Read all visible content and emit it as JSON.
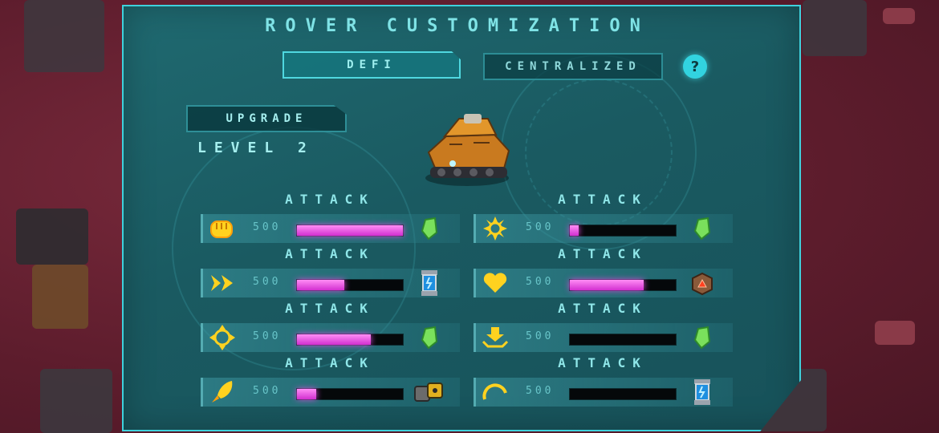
{
  "title": "ROVER CUSTOMIZATION",
  "tabs": {
    "defi": "DEFI",
    "centralized": "CENTRALIZED"
  },
  "help_label": "?",
  "upgrade_label": "UPGRADE",
  "level_label": "LEVEL 2",
  "colors": {
    "accent": "#3fd1dc",
    "bar_fill": "#e04ae0",
    "icon": "#ffd21f",
    "panel": "#1a5a61"
  },
  "stats": [
    {
      "label": "ATTACK",
      "value": "500",
      "icon": "fist-icon",
      "level": 1.0,
      "resource": "green-crystal-icon"
    },
    {
      "label": "ATTACK",
      "value": "500",
      "icon": "sun-gear-icon",
      "level": 0.08,
      "resource": "green-crystal-icon"
    },
    {
      "label": "ATTACK",
      "value": "500",
      "icon": "fast-forward-icon",
      "level": 0.45,
      "resource": "energy-canister-icon"
    },
    {
      "label": "ATTACK",
      "value": "500",
      "icon": "heart-icon",
      "level": 0.7,
      "resource": "loot-crate-icon"
    },
    {
      "label": "ATTACK",
      "value": "500",
      "icon": "crosshair-icon",
      "level": 0.7,
      "resource": "green-crystal-icon"
    },
    {
      "label": "ATTACK",
      "value": "500",
      "icon": "download-tray-icon",
      "level": 0.0,
      "resource": "green-crystal-icon"
    },
    {
      "label": "ATTACK",
      "value": "500",
      "icon": "rocket-icon",
      "level": 0.18,
      "resource": "fuel-barrels-icon"
    },
    {
      "label": "ATTACK",
      "value": "500",
      "icon": "speed-gauge-icon",
      "level": 0.0,
      "resource": "energy-canister-icon"
    }
  ]
}
